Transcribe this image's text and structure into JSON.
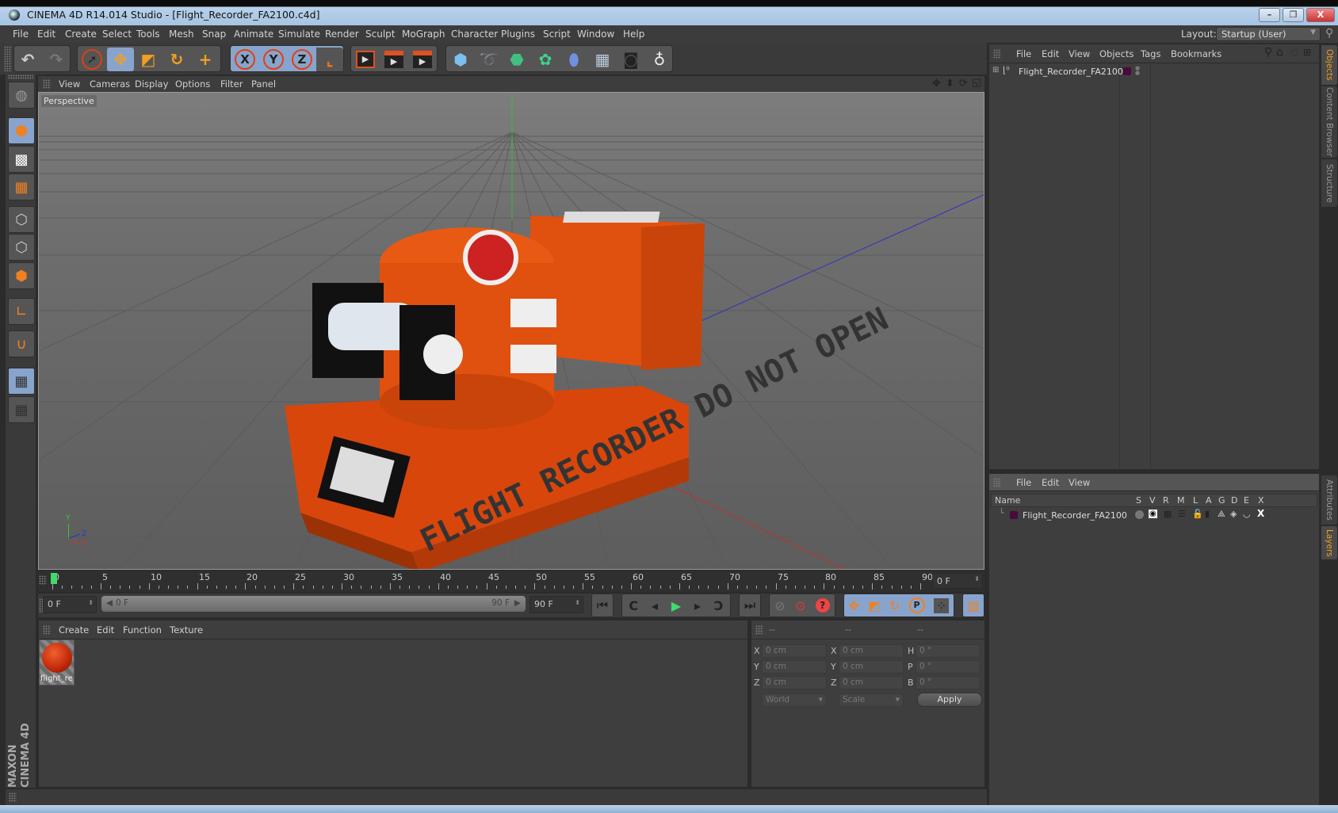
{
  "window": {
    "title": "CINEMA 4D R14.014 Studio - [Flight_Recorder_FA2100.c4d]",
    "buttons": {
      "minimize": "–",
      "restore": "❐",
      "close": "X"
    }
  },
  "menubar": {
    "items": [
      "File",
      "Edit",
      "Create",
      "Select",
      "Tools",
      "Mesh",
      "Snap",
      "Animate",
      "Simulate",
      "Render",
      "Sculpt",
      "MoGraph",
      "Character",
      "Plugins",
      "Script",
      "Window",
      "Help"
    ],
    "layout_label": "Layout:",
    "layout_value": "Startup (User)"
  },
  "toolbar": {
    "groups": [
      {
        "name": "history",
        "tools": [
          {
            "icon": "undo-icon",
            "glyph": "↶"
          },
          {
            "icon": "redo-icon",
            "glyph": "↷"
          }
        ]
      },
      {
        "name": "transform",
        "tools": [
          {
            "icon": "live-select-icon",
            "glyph": "➚"
          },
          {
            "icon": "move-icon",
            "glyph": "✥",
            "active": true
          },
          {
            "icon": "scale-icon",
            "glyph": "◩"
          },
          {
            "icon": "rotate-icon",
            "glyph": "↻"
          },
          {
            "icon": "last-tool-icon",
            "glyph": "+"
          }
        ]
      },
      {
        "name": "axis",
        "tools": [
          {
            "icon": "x-axis-icon",
            "glyph": "X",
            "active": true
          },
          {
            "icon": "y-axis-icon",
            "glyph": "Y",
            "active": true
          },
          {
            "icon": "z-axis-icon",
            "glyph": "Z",
            "active": true
          },
          {
            "icon": "coordinate-system-icon",
            "glyph": "⌞"
          }
        ]
      },
      {
        "name": "render",
        "tools": [
          {
            "icon": "render-view-icon",
            "glyph": "🎬"
          },
          {
            "icon": "render-picture-viewer-icon",
            "glyph": "🎬"
          },
          {
            "icon": "render-settings-icon",
            "glyph": "🎬"
          }
        ]
      },
      {
        "name": "create",
        "tools": [
          {
            "icon": "cube-icon",
            "glyph": "⬢"
          },
          {
            "icon": "spline-pen-icon",
            "glyph": "➰"
          },
          {
            "icon": "subdivision-icon",
            "glyph": "⬣"
          },
          {
            "icon": "cloner-icon",
            "glyph": "✿"
          },
          {
            "icon": "deformer-icon",
            "glyph": "⬮"
          },
          {
            "icon": "floor-icon",
            "glyph": "▦"
          },
          {
            "icon": "camera-icon",
            "glyph": "🎥"
          },
          {
            "icon": "light-icon",
            "glyph": "💡"
          }
        ]
      }
    ]
  },
  "left_toolbar": {
    "tools": [
      {
        "icon": "make-editable-icon",
        "active": false
      },
      {
        "icon": "model-mode-icon",
        "active": true
      },
      {
        "icon": "texture-mode-icon",
        "active": false
      },
      {
        "icon": "workplane-mode-icon",
        "active": false
      },
      {
        "icon": "points-mode-icon",
        "active": false
      },
      {
        "icon": "edges-mode-icon",
        "active": false
      },
      {
        "icon": "polygons-mode-icon",
        "active": false
      },
      {
        "icon": "axis-mode-icon",
        "active": false
      },
      {
        "icon": "snap-magnet-icon",
        "active": false
      },
      {
        "icon": "workplane-lock-icon",
        "active": true
      },
      {
        "icon": "workplane-planar-icon",
        "active": false
      }
    ],
    "brand": "MAXON CINEMA 4D"
  },
  "viewport": {
    "menu": [
      "View",
      "Cameras",
      "Display",
      "Options",
      "Filter",
      "Panel"
    ],
    "camera_label": "Perspective",
    "nav_icons": [
      "pan-icon",
      "zoom-icon",
      "orbit-icon",
      "maximize-icon"
    ],
    "axis_labels": {
      "x": "X",
      "y": "Y",
      "z": "Z"
    },
    "model_text": "FLIGHT RECORDER DO NOT OPEN"
  },
  "timeline": {
    "ticks": [
      "0",
      "5",
      "10",
      "15",
      "20",
      "25",
      "30",
      "35",
      "40",
      "45",
      "50",
      "55",
      "60",
      "65",
      "70",
      "75",
      "80",
      "85",
      "90"
    ],
    "current_frame": "0 F",
    "start_field": "0 F",
    "range_start": "0 F",
    "range_end": "90 F",
    "end_field": "90 F",
    "current_frame_position": 0,
    "max_frame": 90
  },
  "transport": {
    "buttons": [
      {
        "name": "goto-start",
        "glyph": "⏮"
      },
      {
        "name": "goto-prev-key",
        "glyph": "↶"
      },
      {
        "name": "goto-prev-frame",
        "glyph": "◀"
      },
      {
        "name": "play-forward",
        "glyph": "▶"
      },
      {
        "name": "goto-next-frame",
        "glyph": "▶"
      },
      {
        "name": "goto-next-key",
        "glyph": "↷"
      },
      {
        "name": "goto-end",
        "glyph": "⏭"
      },
      {
        "name": "record-keys",
        "glyph": "⊘"
      },
      {
        "name": "auto-keying",
        "glyph": "⊙"
      },
      {
        "name": "keyframe-selection",
        "glyph": "?"
      },
      {
        "name": "record-position",
        "glyph": "✥"
      },
      {
        "name": "record-scale",
        "glyph": "◩"
      },
      {
        "name": "record-rotation",
        "glyph": "↻"
      },
      {
        "name": "record-parameter",
        "glyph": "P"
      },
      {
        "name": "record-pla",
        "glyph": "⁞"
      },
      {
        "name": "timeline-window",
        "glyph": "▥"
      }
    ]
  },
  "material_manager": {
    "menu": [
      "Create",
      "Edit",
      "Function",
      "Texture"
    ],
    "materials": [
      {
        "name": "flight_re"
      }
    ]
  },
  "coordinates": {
    "headers": [
      "--",
      "--",
      "--"
    ],
    "rows": [
      {
        "l1": "X",
        "v1": "0 cm",
        "l2": "X",
        "v2": "0 cm",
        "l3": "H",
        "v3": "0 °"
      },
      {
        "l1": "Y",
        "v1": "0 cm",
        "l2": "Y",
        "v2": "0 cm",
        "l3": "P",
        "v3": "0 °"
      },
      {
        "l1": "Z",
        "v1": "0 cm",
        "l2": "Z",
        "v2": "0 cm",
        "l3": "B",
        "v3": "0 °"
      }
    ],
    "mode_select": "World",
    "scale_select": "Scale",
    "apply_label": "Apply"
  },
  "object_manager": {
    "menu": [
      "File",
      "Edit",
      "View",
      "Objects",
      "Tags",
      "Bookmarks"
    ],
    "objects": [
      {
        "name": "Flight_Recorder_FA2100",
        "layer_color": "#4a0a3a"
      }
    ]
  },
  "layer_manager": {
    "menu": [
      "File",
      "Edit",
      "View"
    ],
    "columns": [
      "Name",
      "S",
      "V",
      "R",
      "M",
      "L",
      "A",
      "G",
      "D",
      "E",
      "X"
    ],
    "layers": [
      {
        "name": "Flight_Recorder_FA2100",
        "color": "#4a0a3a"
      }
    ]
  },
  "right_tabs": {
    "top": [
      {
        "label": "Objects",
        "active": true
      },
      {
        "label": "Content Browser",
        "active": false
      },
      {
        "label": "Structure",
        "active": false
      }
    ],
    "bottom": [
      {
        "label": "Attributes",
        "active": false
      },
      {
        "label": "Layers",
        "active": true
      }
    ]
  },
  "colors": {
    "accent": "#f0a020",
    "active_blue": "#88a4cc",
    "object_orange": "#e0500e"
  }
}
